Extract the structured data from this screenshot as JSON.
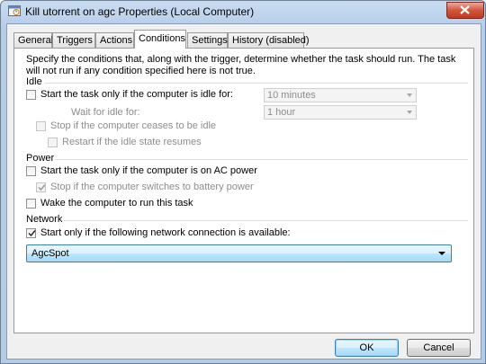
{
  "window": {
    "title": "Kill utorrent on agc Properties (Local Computer)",
    "close_label": "close"
  },
  "tabs": [
    {
      "label": "General"
    },
    {
      "label": "Triggers"
    },
    {
      "label": "Actions"
    },
    {
      "label": "Conditions",
      "active": true
    },
    {
      "label": "Settings"
    },
    {
      "label": "History (disabled)"
    }
  ],
  "intro_text": "Specify the conditions that, along with the trigger, determine whether the task should run.  The task will not run  if any condition specified here is not true.",
  "idle": {
    "section_label": "Idle",
    "start_if_idle": {
      "label": "Start the task only if the computer is idle for:",
      "checked": false,
      "enabled": true
    },
    "idle_for_value": "10 minutes",
    "wait_label": "Wait for idle for:",
    "wait_value": "1 hour",
    "stop_if_ceases": {
      "label": "Stop if the computer ceases to be idle",
      "checked": false,
      "enabled": false
    },
    "restart_if_resumes": {
      "label": "Restart if the idle state resumes",
      "checked": false,
      "enabled": false
    }
  },
  "power": {
    "section_label": "Power",
    "start_on_ac": {
      "label": "Start the task only if the computer is on AC power",
      "checked": false,
      "enabled": true
    },
    "stop_on_battery": {
      "label": "Stop if the computer switches to battery power",
      "checked": true,
      "enabled": false
    },
    "wake_computer": {
      "label": "Wake the computer to run this task",
      "checked": false,
      "enabled": true
    }
  },
  "network": {
    "section_label": "Network",
    "start_if_network": {
      "label": "Start only if the following network connection is available:",
      "checked": true,
      "enabled": true
    },
    "connection_value": "AgcSpot"
  },
  "buttons": {
    "ok_label": "OK",
    "cancel_label": "Cancel"
  },
  "colors": {
    "titlebar": "#c9dcf1",
    "close_button": "#c1391f",
    "default_button_border": "#3c7fb1"
  }
}
